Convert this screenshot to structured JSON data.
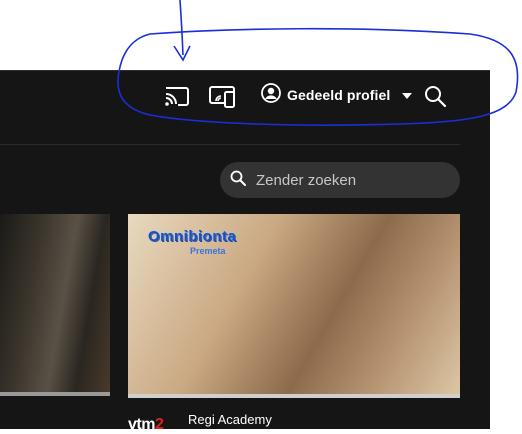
{
  "topbar": {
    "profile_label": "Gedeeld profiel",
    "icons": [
      "cast-icon",
      "remote-icon",
      "avatar-icon",
      "chevron-down-icon",
      "search-icon"
    ]
  },
  "search": {
    "placeholder": "Zender zoeken"
  },
  "cards": [
    {
      "title_overlay": "Omnibionta",
      "subtitle_overlay": "Premeta",
      "channel": "vtm",
      "channel_accent": "2",
      "show_name": "Regi Academy"
    }
  ],
  "colors": {
    "background": "#151515",
    "search_pill": "#333333",
    "annotation": "#1a2fd8"
  }
}
